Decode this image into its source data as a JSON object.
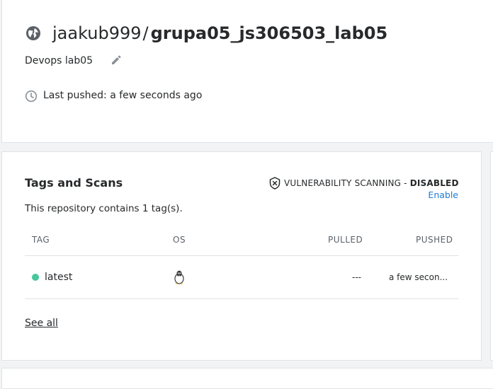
{
  "repo": {
    "namespace": "jaakub999",
    "separator": "/",
    "name": "grupa05_js306503_lab05",
    "description": "Devops lab05",
    "last_pushed": "Last pushed: a few seconds ago",
    "icons": {
      "visibility": "globe-icon",
      "edit": "pencil-icon",
      "time": "clock-icon"
    }
  },
  "tags_card": {
    "title": "Tags and Scans",
    "scan_label": "VULNERABILITY SCANNING - ",
    "scan_status": "DISABLED",
    "enable_link": "Enable",
    "count_text": "This repository contains 1 tag(s).",
    "columns": {
      "tag": "TAG",
      "os": "OS",
      "pulled": "PULLED",
      "pushed": "PUSHED"
    },
    "rows": [
      {
        "tag": "latest",
        "os_icon": "linux-tux-icon",
        "pulled": "---",
        "pushed": "a few secon..."
      }
    ],
    "see_all": "See all"
  },
  "colors": {
    "accent": "#1d7ad4",
    "status_dot": "#45c89c",
    "text": "#27292b",
    "muted": "#5b6167",
    "border": "#dfe3e6",
    "background": "#f1f3f5"
  }
}
